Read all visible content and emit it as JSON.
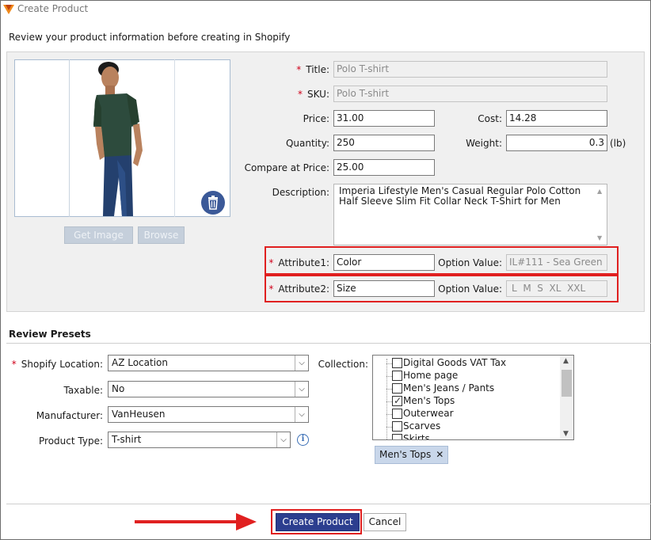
{
  "window": {
    "title": "Create Product",
    "subtitle": "Review your product information before creating in Shopify"
  },
  "image_panel": {
    "get_image_label": "Get Image",
    "browse_label": "Browse",
    "delete_icon": "trash-icon",
    "product_photo": "man-in-green-polo-shirt"
  },
  "product": {
    "title_label": "Title:",
    "title_value": "Polo T-shirt",
    "sku_label": "SKU:",
    "sku_value": "Polo T-shirt",
    "price_label": "Price:",
    "price_value": "31.00",
    "cost_label": "Cost:",
    "cost_value": "14.28",
    "quantity_label": "Quantity:",
    "quantity_value": "250",
    "weight_label": "Weight:",
    "weight_value": "0.3",
    "weight_unit": "(lb)",
    "compare_label": "Compare at Price:",
    "compare_value": "25.00",
    "description_label": "Description:",
    "description_value": "Imperia Lifestyle Men's Casual Regular Polo Cotton Half Sleeve Slim Fit Collar Neck T-Shirt for Men",
    "required_mark": "*"
  },
  "attributes": [
    {
      "label": "Attribute1:",
      "value": "Color",
      "option_label": "Option Value:",
      "option_value": "IL#111 - Sea Green"
    },
    {
      "label": "Attribute2:",
      "value": "Size",
      "option_label": "Option Value:",
      "option_value": "L  M  S  XL  XXL"
    }
  ],
  "presets": {
    "section_title": "Review Presets",
    "location_label": "Shopify Location:",
    "location_value": "AZ Location",
    "taxable_label": "Taxable:",
    "taxable_value": "No",
    "manufacturer_label": "Manufacturer:",
    "manufacturer_value": "VanHeusen",
    "product_type_label": "Product Type:",
    "product_type_value": "T-shirt",
    "info_glyph": "i",
    "collection_label": "Collection:",
    "collections": [
      {
        "label": "Digital Goods VAT Tax",
        "checked": false
      },
      {
        "label": "Home page",
        "checked": false
      },
      {
        "label": "Men's Jeans / Pants",
        "checked": false
      },
      {
        "label": "Men's Tops",
        "checked": true
      },
      {
        "label": "Outerwear",
        "checked": false
      },
      {
        "label": "Scarves",
        "checked": false
      },
      {
        "label": "Skirts",
        "checked": false
      }
    ],
    "selected_tag": "Men's Tops",
    "tag_remove": "✕"
  },
  "footer": {
    "create_label": "Create Product",
    "cancel_label": "Cancel"
  },
  "colors": {
    "accent": "#2c3e8f",
    "highlight": "#e02020",
    "tag_bg": "#c9d7ea"
  }
}
